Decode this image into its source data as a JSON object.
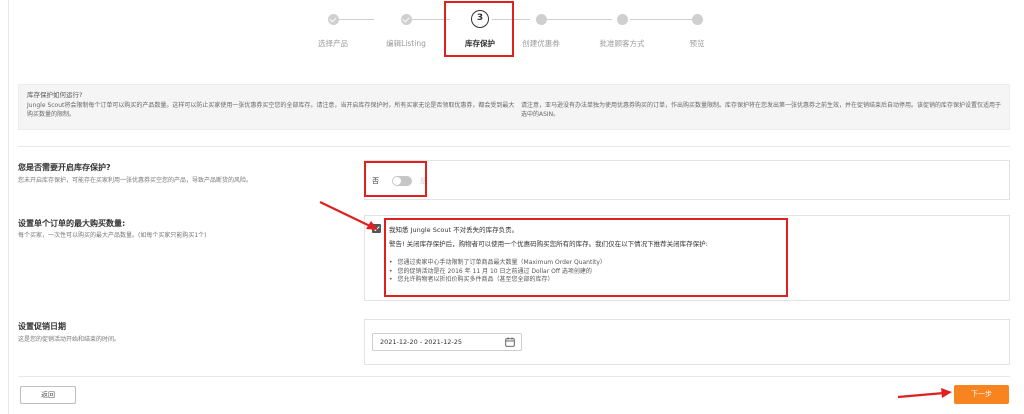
{
  "stepper": {
    "steps": [
      {
        "label": "选择产品",
        "state": "done"
      },
      {
        "label": "编辑Listing",
        "state": "done"
      },
      {
        "label": "库存保护",
        "state": "current",
        "number": "3"
      },
      {
        "label": "创建优惠券",
        "state": "todo"
      },
      {
        "label": "批准顾客方式",
        "state": "todo"
      },
      {
        "label": "预览",
        "state": "todo"
      }
    ]
  },
  "info": {
    "question": "库存保护如何运行?",
    "para1": "Jungle Scout将会限制每个订单可以购买的产品数量。这样可以防止买家使用一张优惠券买空您的全部库存。请注意，当开启库存保护时，所有买家无论是否领取优惠券，都会受到最大购买数量的限制。",
    "para2": "请注意，亚马逊没有办法单独为使用优惠券购买的订单，作出购买数量限制。库存保护将在您发出第一张优惠券之前生效，并在促销结束后自动停用。该促销的库存保护设置仅适用于选中的ASIN。"
  },
  "protection": {
    "title": "您是否需要开启库存保护?",
    "desc": "您未开启库存保护，可能存在买家利用一张优惠券买空您的产品，导致产品断货的风险。",
    "toggle_off_label": "否",
    "toggle_on_label": "是"
  },
  "max_qty": {
    "title": "设置单个订单的最大购买数量:",
    "desc": "每个买家，一次性可以购买的最大产品数量。(如每个买家只能购买1个)",
    "ack": "我知悉 Jungle Scout 不对丢失的库存负责。",
    "warning": "警告! 关闭库存保护后，购物者可以使用一个优惠码购买您所有的库存。我们仅在以下情况下推荐关闭库存保护:",
    "bullets": [
      "您通过卖家中心手动限制了订单商品最大数量（Maximum Order Quantity）",
      "您的促销活动是在 2016 年 11 月 10 日之前通过 Dollar Off 选项创建的",
      "您允许购物者以折扣价购买多件商品（甚至您全部的库存）"
    ]
  },
  "dates": {
    "title": "设置促销日期",
    "desc": "这是您的促销活动开始和结束的时间。",
    "range": "2021-12-20 - 2021-12-25"
  },
  "buttons": {
    "back": "返回",
    "next": "下一步"
  },
  "colors": {
    "accent": "#f7841f",
    "highlight": "#e02020"
  }
}
